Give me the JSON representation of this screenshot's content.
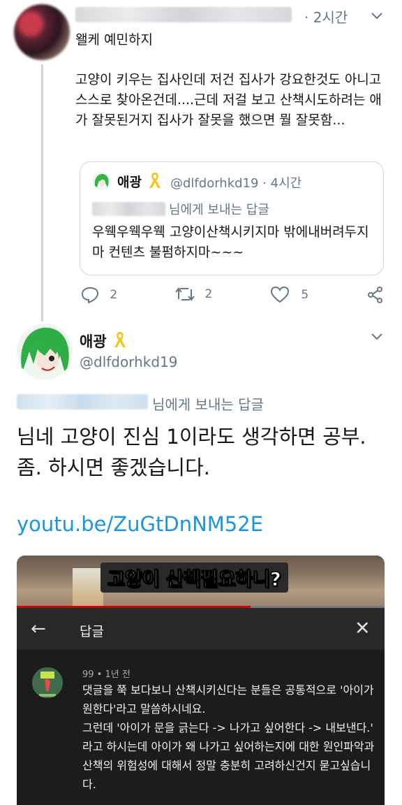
{
  "tweet1": {
    "time": "· 2시간",
    "reply_text": "왤케 예민하지",
    "body": "고양이 키우는 집사인데 저건 집사가 강요한것도 아니고 스스로 찾아온건데....근데 저걸 보고 산책시도하려는 애가 잘못된거지 집사가 잘못을 했으면 뭘 잘못함...",
    "quote": {
      "name": "애광",
      "handle_time": "@dlfdorhkd19 · 4시간",
      "replying_to": "님에게 보내는 답글",
      "body": "우웩우웩우웩 고양이산책시키지마 밖에내버려두지마 컨텐츠 불펌하지마~~~"
    },
    "actions": {
      "replies": "2",
      "retweets": "2",
      "likes": "5"
    }
  },
  "tweet2": {
    "name": "애광",
    "handle": "@dlfdorhkd19",
    "replying_to": "님에게 보내는 답글",
    "text": "님네 고양이 진심 1이라도 생각하면 공부. 좀. 하시면 좋겠습니다.",
    "link": "youtu.be/ZuGtDnNM52E"
  },
  "video": {
    "thumb_title": "고양이 산책필요하니?",
    "header_title": "답글",
    "comment_meta": "99 • 1년 전",
    "comment_text": "댓글을 쭉 보다보니 산책시키신다는 분들은 공통적으로 '아이가 원한다'라고 말씀하시네요.\n그런데 '아이가 문을 긁는다 -> 나가고 싶어한다 -> 내보낸다.' 라고 하시는데 아이가 왜 나가고 싶어하는지에 대한 원인파악과 산책의 위험성에 대해서 정말 충분히 고려하신건지 묻고싶습니다."
  },
  "icons": [
    "chevron-down-icon",
    "reply-icon",
    "retweet-icon",
    "like-icon",
    "share-icon",
    "yellow-ribbon-icon",
    "back-arrow-icon",
    "close-icon"
  ],
  "colors": {
    "link": "#1b95e0",
    "muted": "#657786",
    "border": "#ccd6dd",
    "youtube_red": "#cc0000"
  }
}
